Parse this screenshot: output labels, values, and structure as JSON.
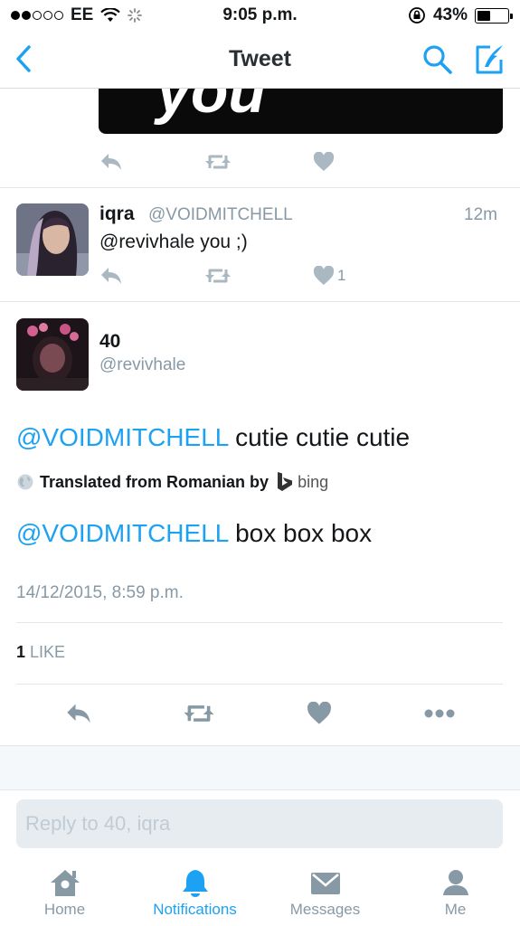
{
  "status_bar": {
    "carrier": "EE",
    "time": "9:05 p.m.",
    "battery": "43%",
    "battery_level": 0.43
  },
  "nav": {
    "title": "Tweet"
  },
  "previous_tweet": {
    "image_text": "you"
  },
  "reply_tweet": {
    "name": "iqra",
    "handle": "@VOIDMITCHELL",
    "time": "12m",
    "text": "@revivhale you ;)",
    "like_count": "1"
  },
  "main_tweet": {
    "name": "40",
    "handle": "@revivhale",
    "mention": "@VOIDMITCHELL",
    "translated_text": "cutie cutie cutie",
    "translated_from": "Translated from Romanian by",
    "translator": "bing",
    "original_text": "box box box",
    "timestamp": "14/12/2015, 8:59 p.m.",
    "likes_count": "1",
    "likes_label": "LIKE"
  },
  "reply_box": {
    "placeholder": "Reply to 40, iqra"
  },
  "tabs": [
    {
      "label": "Home",
      "icon": "home-icon"
    },
    {
      "label": "Notifications",
      "icon": "bell-icon",
      "active": true
    },
    {
      "label": "Messages",
      "icon": "envelope-icon"
    },
    {
      "label": "Me",
      "icon": "person-icon"
    }
  ],
  "colors": {
    "accent": "#1da1f2",
    "muted": "#8899a6",
    "text": "#14171a"
  }
}
